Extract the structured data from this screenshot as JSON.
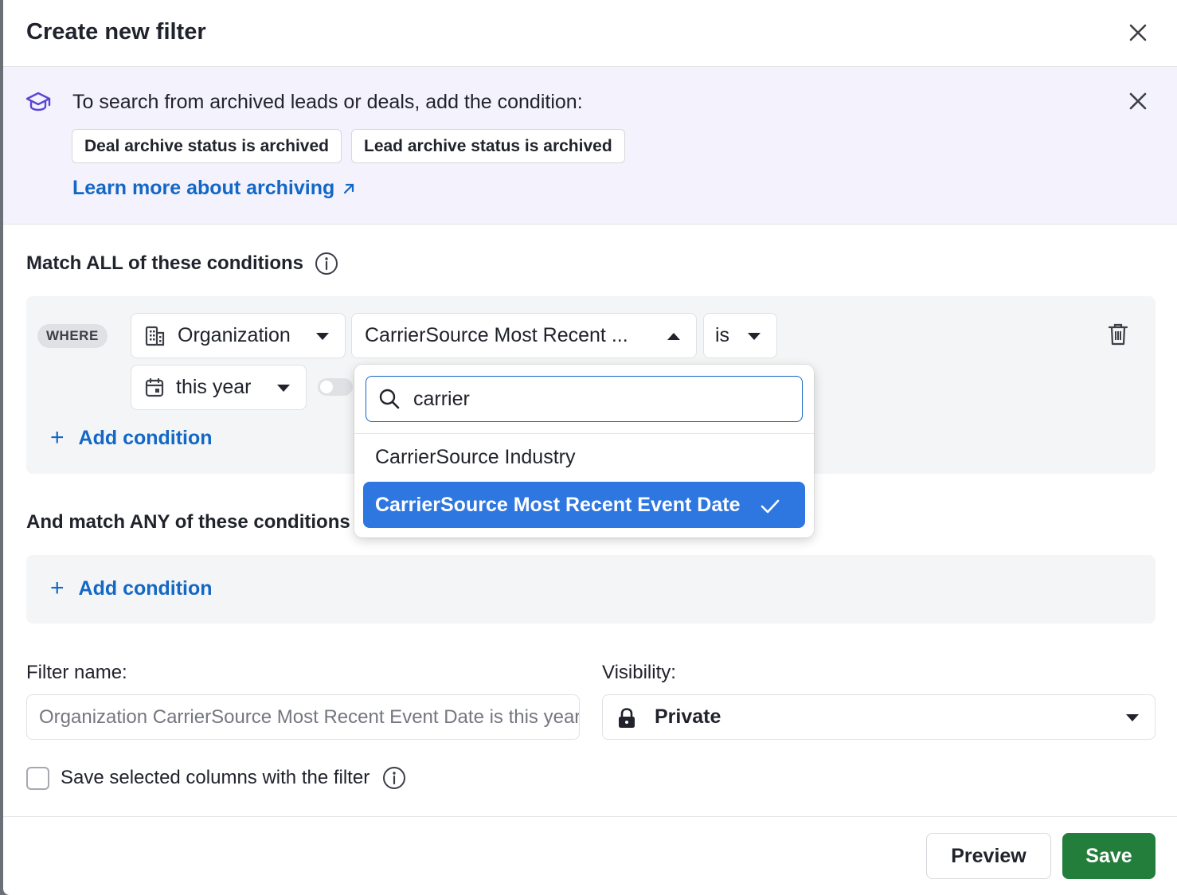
{
  "modal": {
    "title": "Create new filter"
  },
  "banner": {
    "text": "To search from archived leads or deals, add the condition:",
    "chips": [
      "Deal archive status is archived",
      "Lead archive status is archived"
    ],
    "link": "Learn more about archiving"
  },
  "all_section": {
    "title": "Match ALL of these conditions",
    "where_label": "WHERE",
    "entity": "Organization",
    "field": "CarrierSource Most Recent ...",
    "operator": "is",
    "date_value": "this year",
    "add_condition": "Add condition"
  },
  "any_section": {
    "title": "And match ANY of these conditions",
    "add_condition": "Add condition"
  },
  "field_dropdown": {
    "search_value": "carrier",
    "options": [
      {
        "label": "CarrierSource Industry",
        "selected": false
      },
      {
        "label": "CarrierSource Most Recent Event Date",
        "selected": true
      }
    ]
  },
  "filter_name": {
    "label": "Filter name:",
    "placeholder": "Organization CarrierSource Most Recent Event Date is this year"
  },
  "visibility": {
    "label": "Visibility:",
    "value": "Private"
  },
  "save_columns": {
    "label": "Save selected columns with the filter",
    "checked": false
  },
  "footer": {
    "preview": "Preview",
    "save": "Save"
  },
  "colors": {
    "primary": "#237d3b",
    "link": "#1367c5",
    "selected": "#2f77e0",
    "banner_bg": "#f3f2fd"
  }
}
